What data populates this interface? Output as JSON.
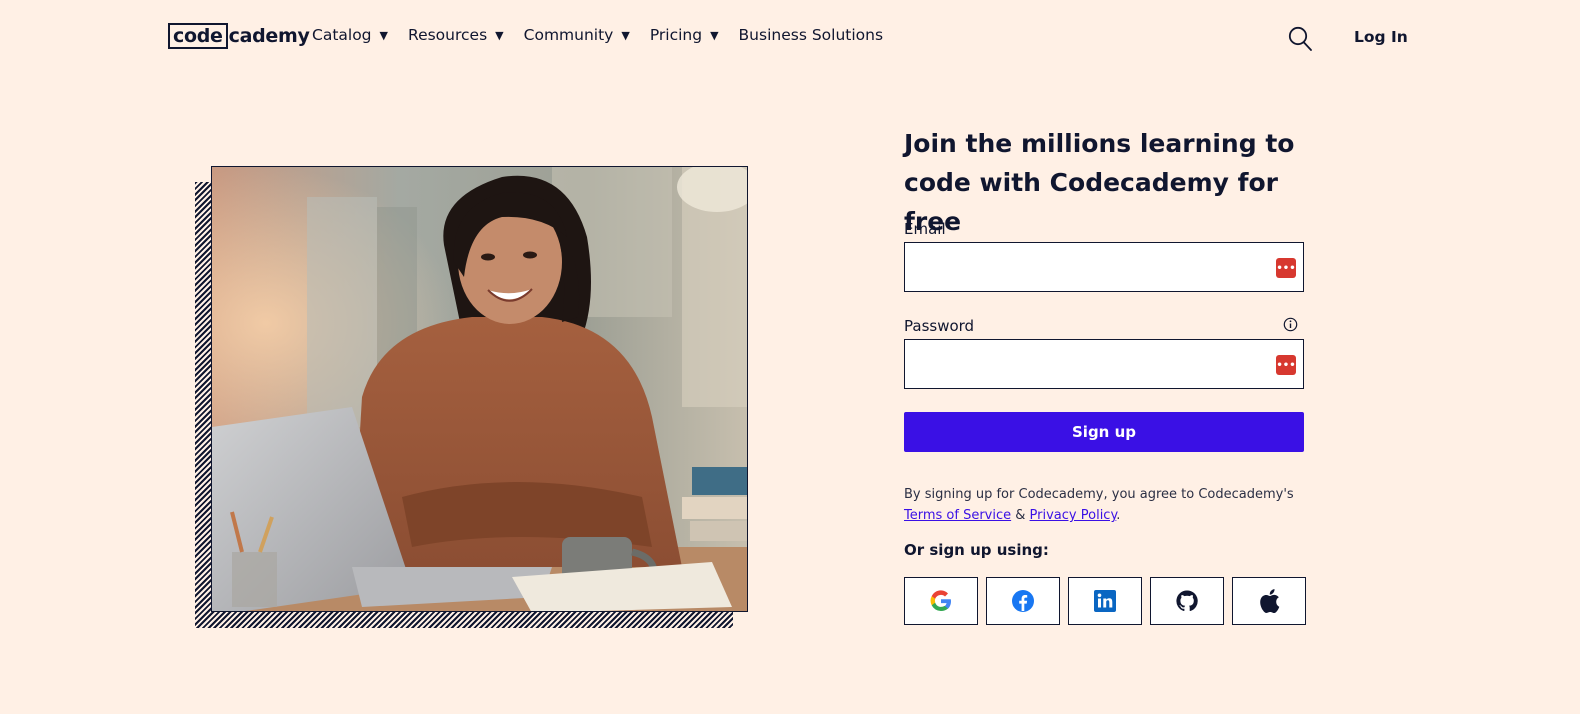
{
  "header": {
    "logo_left": "code",
    "logo_right": "cademy",
    "nav": [
      {
        "label": "Catalog",
        "caret": "▼"
      },
      {
        "label": "Resources",
        "caret": "▼"
      },
      {
        "label": "Community",
        "caret": "▼"
      },
      {
        "label": "Pricing",
        "caret": "▼"
      },
      {
        "label": "Business Solutions"
      }
    ],
    "search_icon": "search-icon",
    "login_label": "Log In"
  },
  "hero": {
    "image_subject": "smiling woman at desk with laptop and mug"
  },
  "form": {
    "headline": "Join the millions learning to code with Codecademy for free",
    "email_label": "Email",
    "email_value": "",
    "password_label": "Password",
    "password_value": "",
    "password_manager_glyph": "•••",
    "signup_label": "Sign up",
    "terms_prefix": "By signing up for Codecademy, you agree to Codecademy's",
    "terms_link": "Terms of Service",
    "terms_amp": "&",
    "privacy_link": "Privacy Policy",
    "terms_suffix": ".",
    "or_label": "Or sign up using:",
    "social": [
      "google-icon",
      "facebook-icon",
      "linkedin-icon",
      "github-icon",
      "apple-icon"
    ]
  },
  "colors": {
    "background": "#fff0e5",
    "text": "#10162f",
    "primary": "#3a10e5",
    "password_manager": "#d7382f"
  }
}
